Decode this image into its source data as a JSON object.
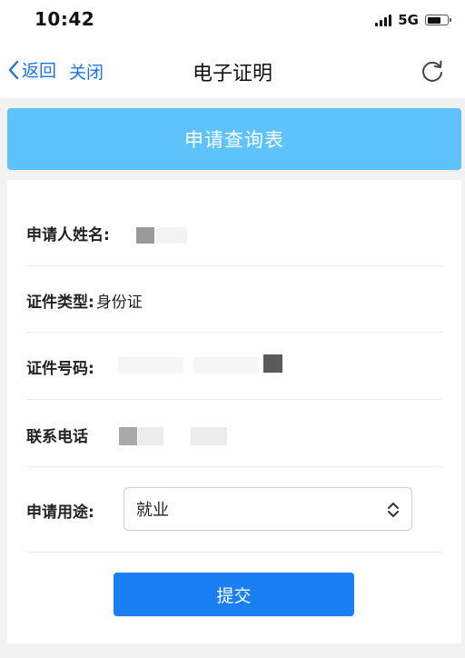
{
  "status_bar": {
    "time": "10:42",
    "network": "5G",
    "signal_icon": "signal-bars-icon",
    "battery_icon": "battery-icon"
  },
  "nav": {
    "back_label": "返回",
    "close_label": "关闭",
    "title": "电子证明",
    "back_icon": "chevron-left-icon",
    "refresh_icon": "refresh-icon"
  },
  "banner": {
    "title": "申请查询表"
  },
  "form": {
    "applicant_name_label": "申请人姓名:",
    "id_type_label": "证件类型:",
    "id_type_value": "身份证",
    "id_number_label": "证件号码:",
    "phone_label": "联系电话",
    "purpose_label": "申请用途:",
    "purpose_value": "就业",
    "purpose_icon": "chevron-up-down-icon",
    "submit_label": "提交"
  },
  "colors": {
    "accent": "#1a73e8",
    "banner": "#5ec3fb",
    "submit": "#1a7ff2",
    "background": "#f2f2f2"
  }
}
